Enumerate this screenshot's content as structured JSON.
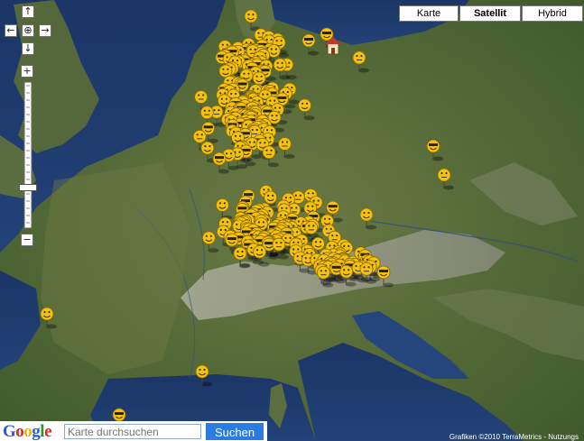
{
  "map_types": [
    {
      "label": "Karte",
      "active": false
    },
    {
      "label": "Satellit",
      "active": true
    },
    {
      "label": "Hybrid",
      "active": false
    }
  ],
  "nav": {
    "pan_up": "↑",
    "pan_left": "←",
    "pan_center": "⊕",
    "pan_right": "→",
    "pan_down": "↓",
    "zoom_in": "+",
    "zoom_out": "−",
    "zoom_level_fraction": 0.72
  },
  "search": {
    "logo_text": "Google",
    "placeholder": "Karte durchsuchen",
    "button_label": "Suchen"
  },
  "copyright": "Grafiken ©2010 TerraMetrics - Nutzungs",
  "colors": {
    "marker_fill": "#f4c20d",
    "marker_stroke": "#8a6a00",
    "water": "#1f3b6b",
    "land": "#4f6b3a"
  },
  "icons": {
    "home_marker": "house-icon",
    "smiley_marker": "smiley-pin-icon"
  },
  "marker_count": 320
}
